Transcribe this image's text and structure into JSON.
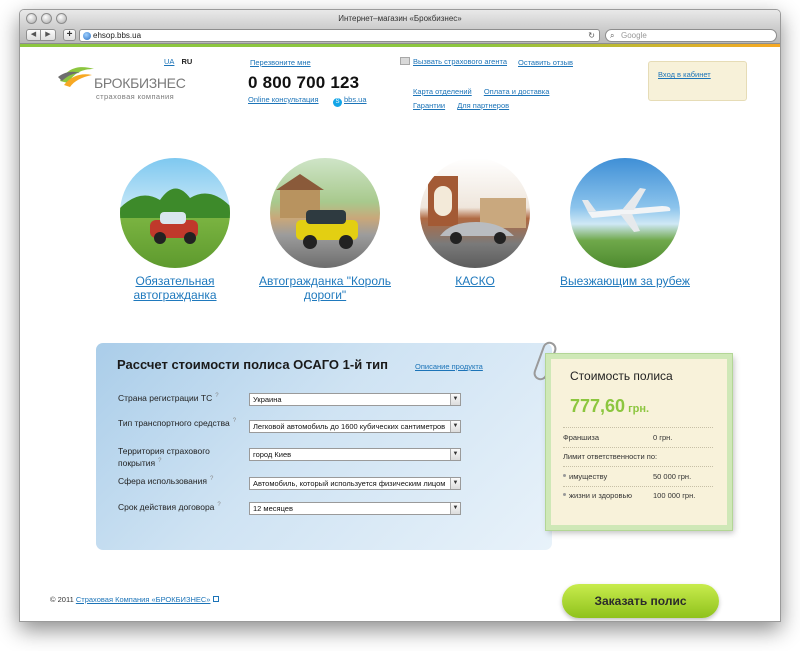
{
  "browser": {
    "title": "Интернет–магазин «Брокбизнес»",
    "url": "ehsop.bbs.ua",
    "search_placeholder": "Google"
  },
  "header": {
    "logo_name": "БРОКБИЗНЕС",
    "logo_sub": "страховая компания",
    "lang_ua": "UA",
    "lang_ru": "RU",
    "callback": "Перезвоните мне",
    "phone": "0 800 700 123",
    "consult": "Online консультация",
    "skype": "bbs.ua",
    "agent": "Вызвать страхового агента",
    "feedback": "Оставить отзыв",
    "nav": [
      "Карта отделений",
      "Оплата и доставка",
      "Гарантии",
      "Для партнеров"
    ],
    "cabinet": "Вход в кабинет"
  },
  "categories": [
    {
      "label": "Обязательная автогражданка"
    },
    {
      "label": "Автогражданка \"Король дороги\""
    },
    {
      "label": "КАСКО"
    },
    {
      "label": "Выезжающим за рубеж"
    }
  ],
  "calculator": {
    "title": "Рассчет стоимости полиса ОСАГО 1-й тип",
    "description_link": "Описание продукта",
    "fields": [
      {
        "label": "Страна регистрации ТС",
        "value": "Украина"
      },
      {
        "label": "Тип транспортного средства",
        "value": "Легковой автомобиль до 1600 кубических сантиметров"
      },
      {
        "label": "Территория страхового покрытия",
        "value": "город Киев"
      },
      {
        "label": "Сфера использования",
        "value": "Автомобиль, который используется физическим лицом"
      },
      {
        "label": "Срок действия договора",
        "value": "12 месяцев"
      }
    ],
    "help_mark": "?"
  },
  "price_card": {
    "title": "Стоимость полиса",
    "amount": "777,60",
    "currency": "грн.",
    "franchise_label": "Франшиза",
    "franchise_value": "0 грн.",
    "limit_label": "Лимит ответственности по:",
    "property_label": "имуществу",
    "property_value": "50 000 грн.",
    "life_label": "жизни и здоровью",
    "life_value": "100 000 грн."
  },
  "order_button": "Заказать полис",
  "footer": {
    "copyright": "© 2011",
    "company": "Страховая Компания «БРОКБИЗНЕС»"
  }
}
